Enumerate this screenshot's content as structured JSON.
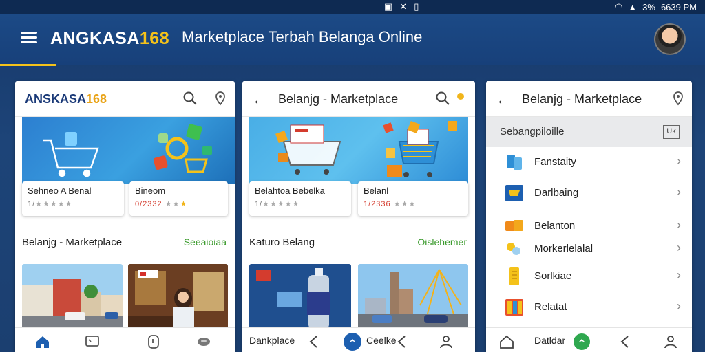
{
  "status_bar": {
    "battery": "3%",
    "time": "6639 PM"
  },
  "app_bar": {
    "brand_text": "ANGKASA",
    "brand_number": "168",
    "title": "Marketplace Terbah Belanga Online"
  },
  "panel1": {
    "brand_text": "ANSKASA",
    "brand_number": "168",
    "card1": {
      "title": "Sehneo A Benal",
      "rating_prefix": "1/",
      "stars": "★★★★★"
    },
    "card2": {
      "title": "Bineom",
      "price": "0/2332",
      "stars": "★★",
      "gold_star": "★"
    },
    "section_title": "Belanjg - Marketplace",
    "section_link": "Seeaioiaa"
  },
  "panel2": {
    "title": "Belanjg - Marketplace",
    "card1": {
      "title": "Belahtoa Bebelka",
      "rating_prefix": "1/",
      "stars": "★★★★★"
    },
    "card2": {
      "title": "Belanl",
      "price": "1/2336",
      "stars": "★★★"
    },
    "section_title": "Katuro Belang",
    "section_link": "Oislehemer",
    "nav_left_label": "Dankplace",
    "nav_right_label": "Ceelke"
  },
  "panel3": {
    "title": "Belanjg - Marketplace",
    "list_header": "Sebangpiloille",
    "list_header_btn": "Uk",
    "items": [
      {
        "label": "Fanstaity"
      },
      {
        "label": "Darlbaing"
      },
      {
        "label": "Belanton"
      },
      {
        "label": "Morkerlelalal"
      },
      {
        "label": "Sorlkiae"
      },
      {
        "label": "Relatat"
      }
    ],
    "nav_label": "Datldar"
  },
  "colors": {
    "brand_gold": "#f4c21a",
    "link_green": "#3c9b2e",
    "app_bar_blue": "#1c4a86"
  }
}
